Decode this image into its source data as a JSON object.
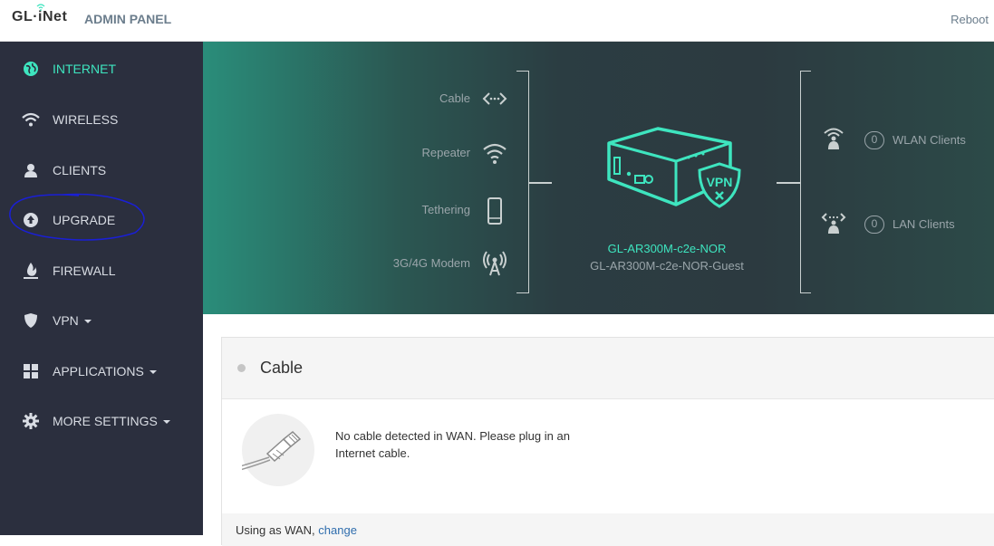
{
  "header": {
    "logo_text": "GL·iNet",
    "admin_label": "ADMIN PANEL",
    "reboot_label": "Reboot"
  },
  "sidebar": {
    "items": [
      {
        "label": "INTERNET",
        "icon": "globe-icon"
      },
      {
        "label": "WIRELESS",
        "icon": "wifi-icon"
      },
      {
        "label": "CLIENTS",
        "icon": "user-icon"
      },
      {
        "label": "UPGRADE",
        "icon": "upload-icon"
      },
      {
        "label": "FIREWALL",
        "icon": "fire-icon"
      },
      {
        "label": "VPN",
        "icon": "shield-icon"
      },
      {
        "label": "APPLICATIONS",
        "icon": "grid-icon"
      },
      {
        "label": "MORE SETTINGS",
        "icon": "gear-icon"
      }
    ]
  },
  "hero": {
    "sources": [
      {
        "label": "Cable",
        "icon": "cable-arrows-icon"
      },
      {
        "label": "Repeater",
        "icon": "wifi-icon"
      },
      {
        "label": "Tethering",
        "icon": "phone-icon"
      },
      {
        "label": "3G/4G Modem",
        "icon": "antenna-icon"
      }
    ],
    "router": {
      "badge": "VPN",
      "ssid": "GL-AR300M-c2e-NOR",
      "guest_ssid": "GL-AR300M-c2e-NOR-Guest"
    },
    "clients": [
      {
        "label": "WLAN Clients",
        "count": "0",
        "icon": "wireless-client-icon"
      },
      {
        "label": "LAN Clients",
        "count": "0",
        "icon": "lan-client-icon"
      }
    ]
  },
  "panel": {
    "title": "Cable",
    "message": "No cable detected in WAN. Please plug in an Internet cable.",
    "footer_text": "Using as WAN,",
    "footer_link": "change"
  },
  "colors": {
    "accent": "#3ee5bf",
    "sidebar_bg": "#2b2f3e",
    "link": "#2f6dad"
  }
}
